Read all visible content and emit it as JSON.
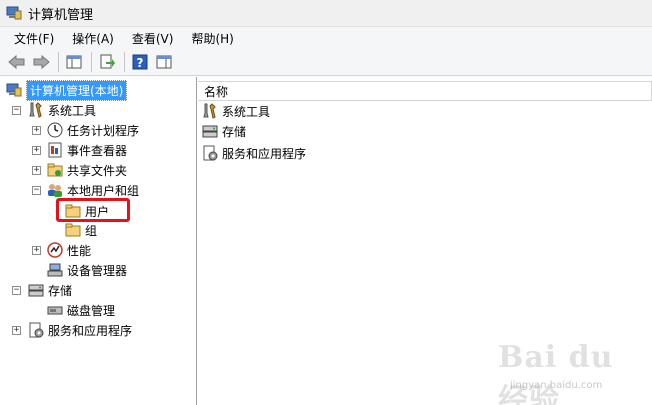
{
  "window": {
    "title": "计算机管理"
  },
  "menu": [
    {
      "label": "文件(F)"
    },
    {
      "label": "操作(A)"
    },
    {
      "label": "查看(V)"
    },
    {
      "label": "帮助(H)"
    }
  ],
  "toolbar": {
    "buttons": [
      "back-arrow-icon",
      "forward-arrow-icon",
      "console-tree-icon",
      "export-list-icon",
      "help-icon",
      "action-pane-icon"
    ]
  },
  "tree": {
    "root": "计算机管理(本地)",
    "system_tools": "系统工具",
    "task_scheduler": "任务计划程序",
    "event_viewer": "事件查看器",
    "shared_folders": "共享文件夹",
    "local_users_groups": "本地用户和组",
    "users": "用户",
    "groups": "组",
    "performance": "性能",
    "device_manager": "设备管理器",
    "storage": "存储",
    "disk_management": "磁盘管理",
    "services_apps": "服务和应用程序"
  },
  "list": {
    "column_name": "名称",
    "rows": [
      "系统工具",
      "存储",
      "服务和应用程序"
    ]
  },
  "watermark": {
    "logo": "Bai du 经验",
    "url": "jingyan.baidu.com"
  },
  "colors": {
    "selection": "#3399ff",
    "highlight_box": "#e8101a",
    "folder": "#f4d27a"
  }
}
